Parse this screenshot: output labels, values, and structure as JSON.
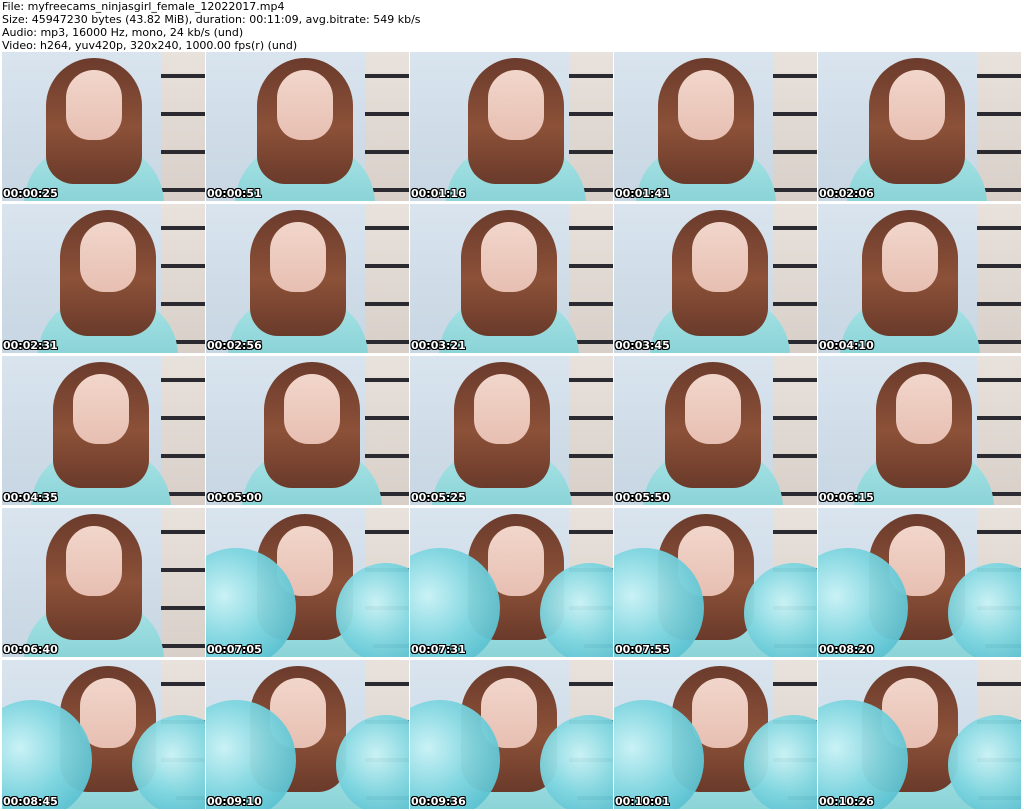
{
  "header": {
    "file": "File: myfreecams_ninjasgirl_female_12022017.mp4",
    "size": "Size: 45947230 bytes (43.82 MiB), duration: 00:11:09, avg.bitrate: 549 kb/s",
    "audio": "Audio: mp3, 16000 Hz, mono, 24 kb/s (und)",
    "video": "Video: h264, yuv420p, 320x240, 1000.00 fps(r) (und)"
  },
  "thumbnails": [
    {
      "time": "00:00:25",
      "blanket": false
    },
    {
      "time": "00:00:51",
      "blanket": false
    },
    {
      "time": "00:01:16",
      "blanket": false
    },
    {
      "time": "00:01:41",
      "blanket": false
    },
    {
      "time": "00:02:06",
      "blanket": false
    },
    {
      "time": "00:02:31",
      "blanket": false
    },
    {
      "time": "00:02:56",
      "blanket": false
    },
    {
      "time": "00:03:21",
      "blanket": false
    },
    {
      "time": "00:03:45",
      "blanket": false
    },
    {
      "time": "00:04:10",
      "blanket": false
    },
    {
      "time": "00:04:35",
      "blanket": false
    },
    {
      "time": "00:05:00",
      "blanket": false
    },
    {
      "time": "00:05:25",
      "blanket": false
    },
    {
      "time": "00:05:50",
      "blanket": false
    },
    {
      "time": "00:06:15",
      "blanket": false
    },
    {
      "time": "00:06:40",
      "blanket": false
    },
    {
      "time": "00:07:05",
      "blanket": true
    },
    {
      "time": "00:07:31",
      "blanket": true
    },
    {
      "time": "00:07:55",
      "blanket": true
    },
    {
      "time": "00:08:20",
      "blanket": true
    },
    {
      "time": "00:08:45",
      "blanket": true
    },
    {
      "time": "00:09:10",
      "blanket": true
    },
    {
      "time": "00:09:36",
      "blanket": true
    },
    {
      "time": "00:10:01",
      "blanket": true
    },
    {
      "time": "00:10:26",
      "blanket": true
    }
  ]
}
